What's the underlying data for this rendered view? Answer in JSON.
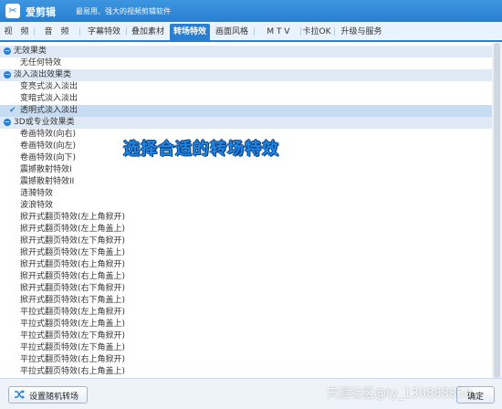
{
  "app": {
    "name": "爱剪辑",
    "slogan": "最易用、强大的视频剪辑软件"
  },
  "tabs": [
    {
      "label": "视　频"
    },
    {
      "label": "音　频"
    },
    {
      "label": "字幕特效"
    },
    {
      "label": "叠加素材"
    },
    {
      "label": "转场特效",
      "active": true
    },
    {
      "label": "画面风格"
    },
    {
      "label": "M T V"
    },
    {
      "label": "卡拉OK"
    },
    {
      "label": "升级与服务"
    }
  ],
  "effects": {
    "cat1": {
      "label": "无效果类",
      "items": [
        "无任何特效"
      ]
    },
    "cat2": {
      "label": "淡入淡出效果类",
      "items": [
        "变亮式淡入淡出",
        "变暗式淡入淡出",
        "透明式淡入淡出"
      ],
      "selected": "透明式淡入淡出"
    },
    "cat3": {
      "label": "3D或专业效果类",
      "items": [
        "卷画特效(向右)",
        "卷画特效(向左)",
        "卷画特效(向下)",
        "震撼散射特效I",
        "震撼散射特效II",
        "涟漪特效",
        "波浪特效",
        "掀开式翻页特效(左上角掀开)",
        "掀开式翻页特效(左上角盖上)",
        "掀开式翻页特效(左下角掀开)",
        "掀开式翻页特效(左下角盖上)",
        "掀开式翻页特效(右上角掀开)",
        "掀开式翻页特效(右上角盖上)",
        "掀开式翻页特效(右下角掀开)",
        "掀开式翻页特效(右下角盖上)",
        "平拉式翻页特效(左上角掀开)",
        "平拉式翻页特效(左上角盖上)",
        "平拉式翻页特效(左下角掀开)",
        "平拉式翻页特效(左下角盖上)",
        "平拉式翻页特效(右上角掀开)",
        "平拉式翻页特效(右上角盖上)"
      ]
    }
  },
  "overlay_caption": "选择合适的转场特效",
  "buttons": {
    "random": "设置随机转场",
    "ok": "确定"
  },
  "watermark": "天涯社区@ty_130888850",
  "colors": {
    "accent": "#2a7fd0",
    "selected_row": "#c5dcf3"
  }
}
